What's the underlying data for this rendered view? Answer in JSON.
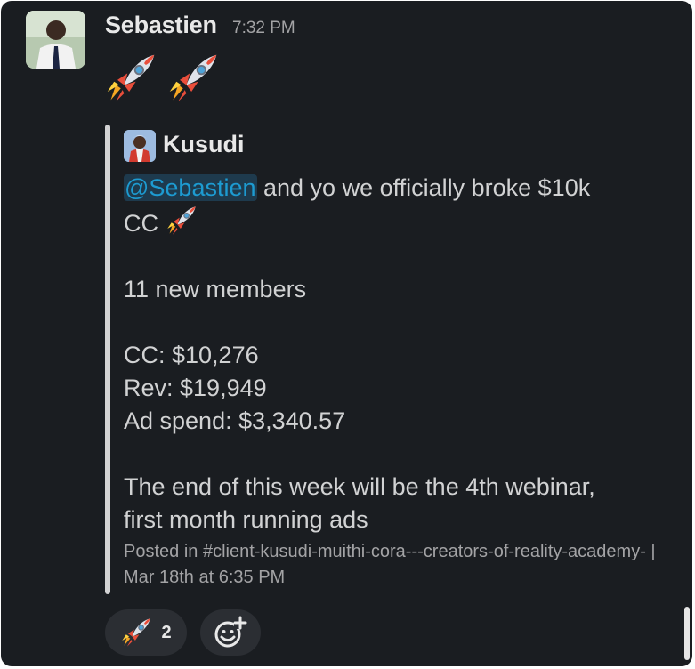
{
  "message": {
    "author": "Sebastien",
    "time": "7:32 PM",
    "rocket_emoji_count": 2,
    "avatar_icon": "user-avatar"
  },
  "quote": {
    "author": "Kusudi",
    "mention": "@Sebastien",
    "line1_rest": " and yo we officially broke $10k",
    "line2": "CC",
    "line3": "11 new members",
    "line4": "CC: $10,276",
    "line5": "Rev: $19,949",
    "line6": "Ad spend: $3,340.57",
    "line7": "The end of this week will be the 4th webinar,",
    "line8": "first month running ads",
    "footer": "Posted in #client-kusudi-muithi-cora---creators-of-reality-academy- | Mar 18th at 6:35 PM"
  },
  "reactions": {
    "rocket_count": "2",
    "add_reaction_icon": "add-emoji-icon"
  },
  "colors": {
    "background": "#1a1d21",
    "mention": "#1d9bd1",
    "text": "#d1d2d3"
  }
}
